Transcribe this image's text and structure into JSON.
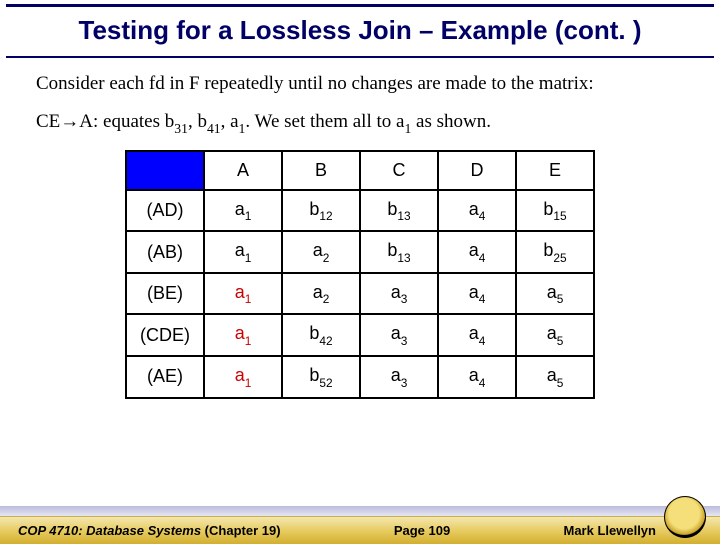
{
  "title": "Testing for a Lossless Join – Example (cont. )",
  "para1": "Consider each fd in F repeatedly until no changes are made to the matrix:",
  "para2_prefix": "CE",
  "para2_target": "A: equates b",
  "para2_parts": {
    "b31": "31",
    "b41": "41",
    "a1": "1",
    "a1b": "1"
  },
  "para2_mid1": ", b",
  "para2_mid2": ", a",
  "para2_mid3": ".  We set them all to a",
  "para2_suffix": " as shown.",
  "columns": [
    "A",
    "B",
    "C",
    "D",
    "E"
  ],
  "rows": [
    {
      "head": "(AD)",
      "cells": [
        {
          "p": "a",
          "s": "1"
        },
        {
          "p": "b",
          "s": "12"
        },
        {
          "p": "b",
          "s": "13"
        },
        {
          "p": "a",
          "s": "4"
        },
        {
          "p": "b",
          "s": "15"
        }
      ]
    },
    {
      "head": "(AB)",
      "cells": [
        {
          "p": "a",
          "s": "1"
        },
        {
          "p": "a",
          "s": "2"
        },
        {
          "p": "b",
          "s": "13"
        },
        {
          "p": "a",
          "s": "4"
        },
        {
          "p": "b",
          "s": "25"
        }
      ]
    },
    {
      "head": "(BE)",
      "cells": [
        {
          "p": "a",
          "s": "1",
          "red": true
        },
        {
          "p": "a",
          "s": "2"
        },
        {
          "p": "a",
          "s": "3"
        },
        {
          "p": "a",
          "s": "4"
        },
        {
          "p": "a",
          "s": "5"
        }
      ]
    },
    {
      "head": "(CDE)",
      "cells": [
        {
          "p": "a",
          "s": "1",
          "red": true
        },
        {
          "p": "b",
          "s": "42"
        },
        {
          "p": "a",
          "s": "3"
        },
        {
          "p": "a",
          "s": "4"
        },
        {
          "p": "a",
          "s": "5"
        }
      ]
    },
    {
      "head": "(AE)",
      "cells": [
        {
          "p": "a",
          "s": "1",
          "red": true
        },
        {
          "p": "b",
          "s": "52"
        },
        {
          "p": "a",
          "s": "3"
        },
        {
          "p": "a",
          "s": "4"
        },
        {
          "p": "a",
          "s": "5"
        }
      ]
    }
  ],
  "footer": {
    "course_prefix": "COP 4710: Database Systems",
    "course_chapter": "  (Chapter 19)",
    "page": "Page 109",
    "author": "Mark Llewellyn"
  }
}
